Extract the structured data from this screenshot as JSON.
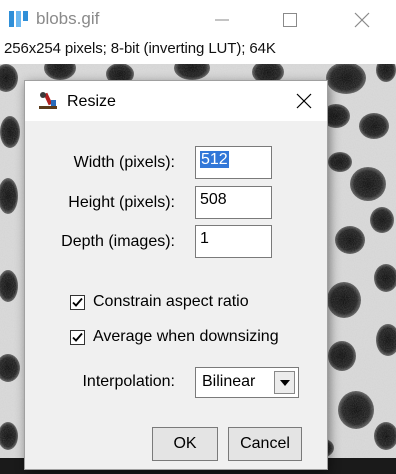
{
  "window": {
    "title": "blobs.gif",
    "controls": [
      "minimize",
      "maximize",
      "close"
    ]
  },
  "image_info": "256x254 pixels; 8-bit (inverting LUT); 64K",
  "dialog": {
    "title": "Resize",
    "fields": [
      {
        "label": "Width (pixels):",
        "value": "512"
      },
      {
        "label": "Height (pixels):",
        "value": "508"
      },
      {
        "label": "Depth (images):",
        "value": "1"
      }
    ],
    "checkboxes": [
      {
        "label": "Constrain aspect ratio",
        "checked": true
      },
      {
        "label": "Average when downsizing",
        "checked": true
      }
    ],
    "interpolation": {
      "label": "Interpolation:",
      "value": "Bilinear"
    },
    "ok_label": "OK",
    "cancel_label": "Cancel"
  },
  "colors": {
    "selection": "#3277d8",
    "dialog_bg": "#f0f0f0",
    "title_text": "#8a8a8a"
  }
}
